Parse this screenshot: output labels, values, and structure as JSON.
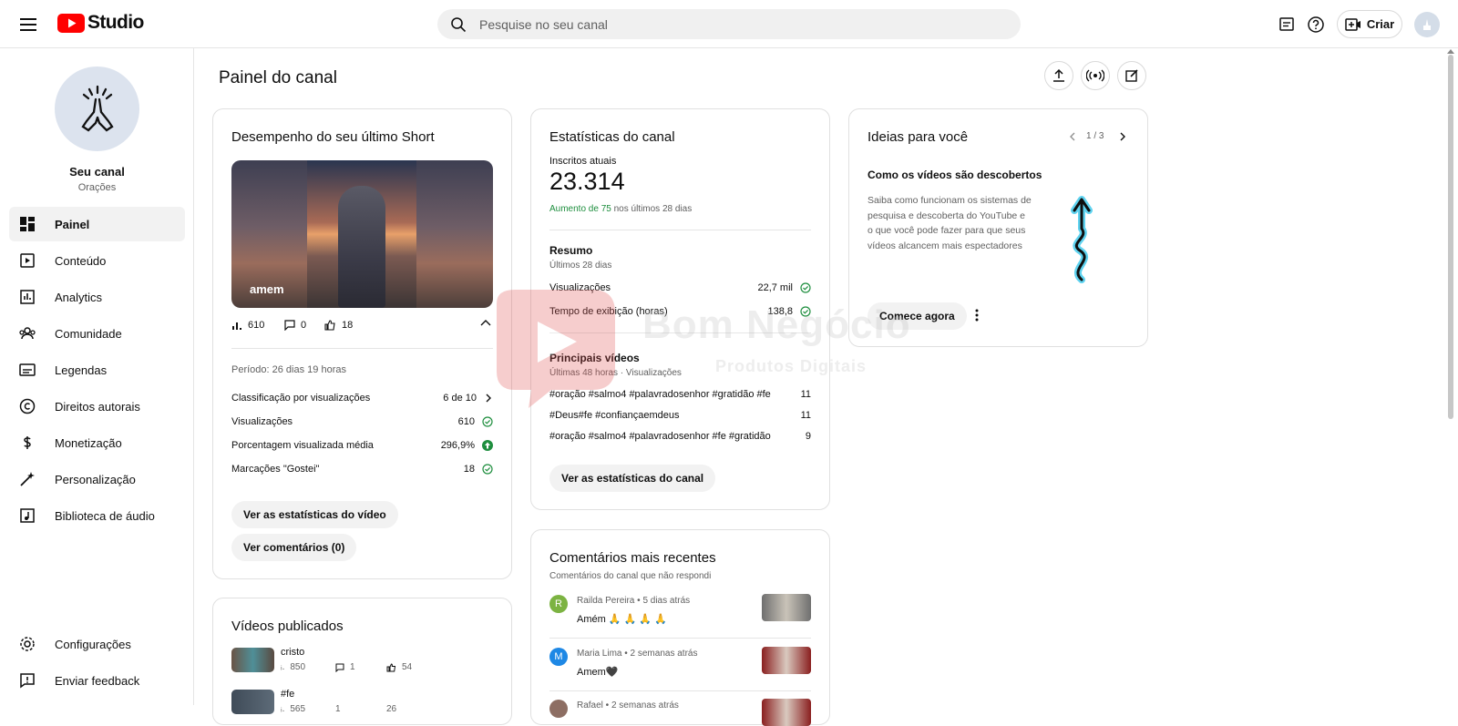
{
  "header": {
    "logo_text": "Studio",
    "search_placeholder": "Pesquise no seu canal",
    "create_label": "Criar",
    "icons": [
      "menu-icon",
      "feedback-icon",
      "help-icon",
      "create-video-icon",
      "account-avatar"
    ]
  },
  "sidebar": {
    "channel_title": "Seu canal",
    "channel_name": "Orações",
    "items": [
      {
        "label": "Painel",
        "icon": "dashboard-icon",
        "active": true
      },
      {
        "label": "Conteúdo",
        "icon": "content-icon"
      },
      {
        "label": "Analytics",
        "icon": "analytics-icon"
      },
      {
        "label": "Comunidade",
        "icon": "community-icon"
      },
      {
        "label": "Legendas",
        "icon": "subtitles-icon"
      },
      {
        "label": "Direitos autorais",
        "icon": "copyright-icon"
      },
      {
        "label": "Monetização",
        "icon": "monetization-icon"
      },
      {
        "label": "Personalização",
        "icon": "customization-icon"
      },
      {
        "label": "Biblioteca de áudio",
        "icon": "audio-library-icon"
      }
    ],
    "bottom_items": [
      {
        "label": "Configurações",
        "icon": "settings-icon"
      },
      {
        "label": "Enviar feedback",
        "icon": "send-feedback-icon"
      }
    ]
  },
  "main": {
    "title": "Painel do canal",
    "short_card": {
      "title": "Desempenho do seu último Short",
      "thumb_label": "amem",
      "views": "610",
      "comments": "0",
      "likes": "18",
      "period": "Período: 26 dias 19 horas",
      "rows": [
        {
          "label": "Classificação por visualizações",
          "value": "6 de 10"
        },
        {
          "label": "Visualizações",
          "value": "610"
        },
        {
          "label": "Porcentagem visualizada média",
          "value": "296,9%"
        },
        {
          "label": "Marcações \"Gostei\"",
          "value": "18"
        }
      ],
      "btn_stats": "Ver as estatísticas do vídeo",
      "btn_comments": "Ver comentários (0)"
    },
    "published_card": {
      "title": "Vídeos publicados",
      "videos": [
        {
          "title": "cristo",
          "views": "850",
          "comments": "1",
          "likes": "54"
        },
        {
          "title": "#fe",
          "views": "565",
          "comments": "1",
          "likes": "26"
        }
      ]
    },
    "stats_card": {
      "title": "Estatísticas do canal",
      "subs_label": "Inscritos atuais",
      "subs_value": "23.314",
      "growth_green": "Aumento de 75",
      "growth_rest": " nos últimos 28 dias",
      "summary_title": "Resumo",
      "summary_period": "Últimos 28 dias",
      "summary_rows": [
        {
          "label": "Visualizações",
          "value": "22,7 mil"
        },
        {
          "label": "Tempo de exibição (horas)",
          "value": "138,8"
        }
      ],
      "top_title": "Principais vídeos",
      "top_period": "Últimas 48 horas · Visualizações",
      "top_rows": [
        {
          "label": "#oração #salmo4 #palavradosenhor #gratidão #fe",
          "value": "11"
        },
        {
          "label": "#Deus#fe #confiançaemdeus",
          "value": "11"
        },
        {
          "label": "#oração #salmo4 #palavradosenhor #fe #gratidão",
          "value": "9"
        }
      ],
      "btn": "Ver as estatísticas do canal"
    },
    "comments_card": {
      "title": "Comentários mais recentes",
      "subtitle": "Comentários do canal que não respondi",
      "items": [
        {
          "initial": "R",
          "author": "Railda Pereira",
          "time": "5 dias atrás",
          "text": "Amém 🙏 🙏 🙏 🙏",
          "color": "#7cb342"
        },
        {
          "initial": "M",
          "author": "Maria Lima",
          "time": "2 semanas atrás",
          "text": "Amem🖤",
          "color": "#1e88e5"
        },
        {
          "initial": "",
          "author": "Rafael",
          "time": "2 semanas atrás",
          "text": "",
          "color": "#8d6e63"
        }
      ]
    },
    "ideas_card": {
      "title": "Ideias para você",
      "pager": "1 / 3",
      "subtitle": "Como os vídeos são descobertos",
      "body": "Saiba como funcionam os sistemas de pesquisa e descoberta do YouTube e o que você pode fazer para que seus vídeos alcancem mais espectadores",
      "btn": "Comece agora"
    },
    "watermark": {
      "title": "Bom Negócio",
      "subtitle": "Produtos Digitais"
    }
  },
  "colors": {
    "brand_red": "#ff0000",
    "green": "#1e8e3e",
    "muted": "#606060"
  }
}
